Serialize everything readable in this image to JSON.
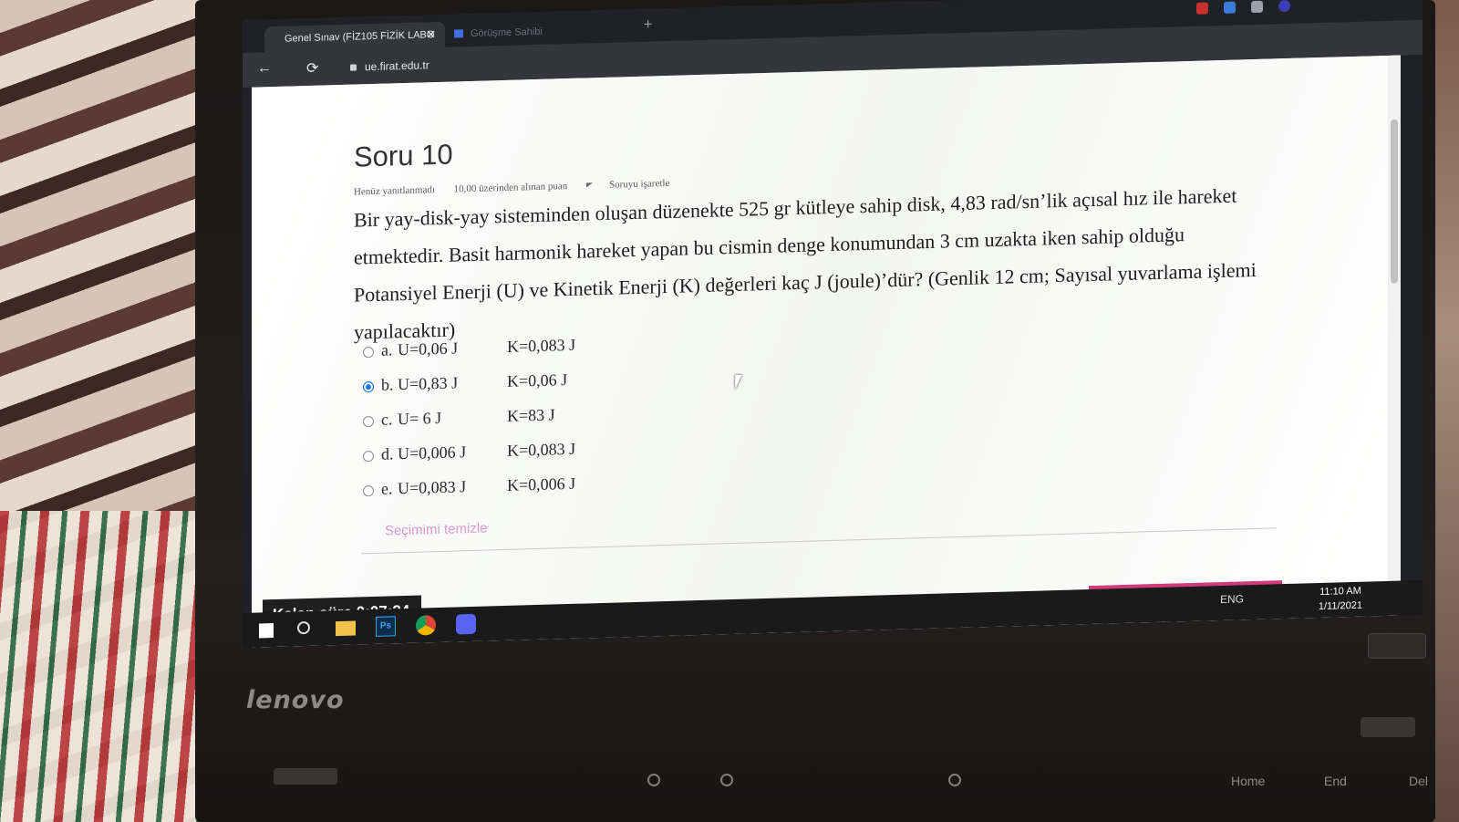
{
  "browser": {
    "tab_title": "Genel Sınav (FİZ105 FİZİK LABO",
    "tab_close": "✕",
    "tab2_title": "Görüşme Sahibi",
    "new_tab": "+",
    "url": "ue.firat.edu.tr",
    "back": "←",
    "reload": "⟳"
  },
  "question": {
    "title": "Soru 10",
    "status": "Henüz yanıtlanmadı",
    "grade": "10,00 üzerinden alınan puan",
    "flag_label": "Soruyu işaretle",
    "text": "Bir yay-disk-yay sisteminden oluşan düzenekte 525 gr kütleye sahip disk, 4,83 rad/sn’lik açısal hız ile hareket etmektedir. Basit harmonik hareket yapan bu cismin denge konumundan 3 cm uzakta iken sahip olduğu Potansiyel Enerji (U) ve Kinetik Enerji (K) değerleri kaç J (joule)’dür? (Genlik 12 cm; Sayısal yuvarlama işlemi yapılacaktır)",
    "options": [
      {
        "letter": "a.",
        "u": "U=0,06 J",
        "k": "K=0,083 J",
        "selected": false
      },
      {
        "letter": "b.",
        "u": "U=0,83 J",
        "k": "K=0,06 J",
        "selected": true
      },
      {
        "letter": "c.",
        "u": "U= 6 J",
        "k": "K=83 J",
        "selected": false
      },
      {
        "letter": "d.",
        "u": "U=0,006 J",
        "k": "K=0,083 J",
        "selected": false
      },
      {
        "letter": "e.",
        "u": "U=0,083 J",
        "k": "K=0,006 J",
        "selected": false
      }
    ],
    "clear_choice": "Seçimimi temizle"
  },
  "timer": {
    "label": "Kalan süre 0:07:24"
  },
  "taskbar": {
    "tray_lang": "ENG",
    "time": "11:10 AM",
    "date": "1/11/2021",
    "ps_label": "Ps"
  },
  "laptop": {
    "brand": "lenovo",
    "keys": [
      "Home",
      "End",
      "Del"
    ]
  },
  "colors": {
    "selected_radio": "#1a73e8",
    "clear_link": "#d79bd0",
    "progress_pink": "#d23b79"
  },
  "icons": [
    "back-arrow-icon",
    "reload-icon",
    "lock-icon",
    "flag-icon",
    "windows-start-icon",
    "search-icon",
    "file-explorer-icon",
    "photoshop-icon",
    "chrome-icon",
    "discord-icon",
    "mouse-cursor-icon"
  ]
}
